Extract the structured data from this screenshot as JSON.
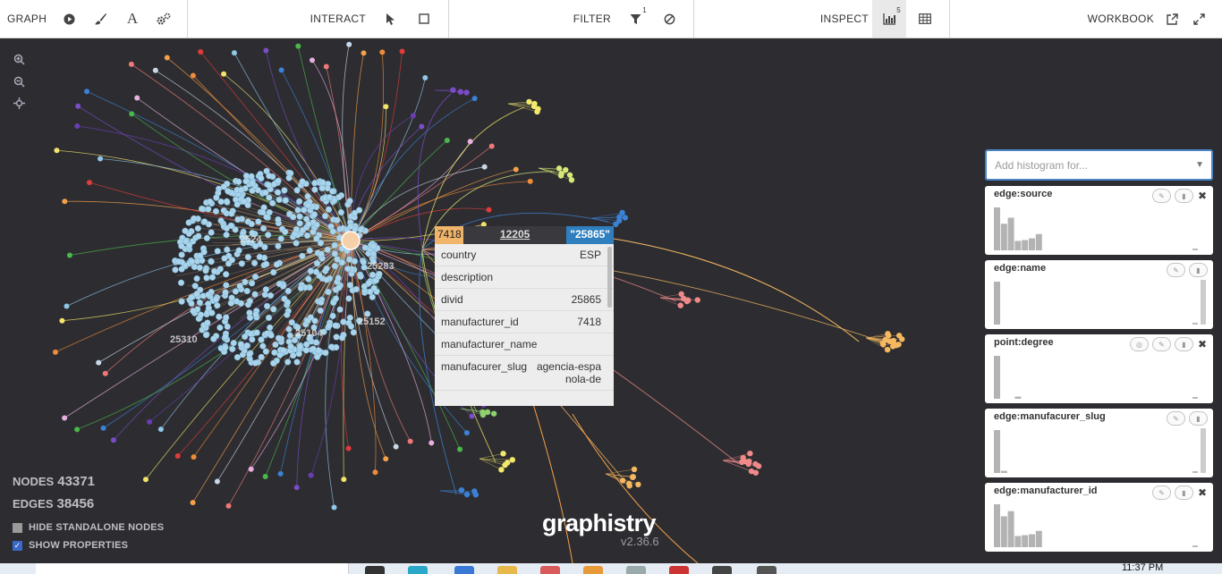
{
  "toolbar": {
    "graph_label": "GRAPH",
    "interact_label": "INTERACT",
    "filter_label": "FILTER",
    "filter_count": "1",
    "inspect_label": "INSPECT",
    "inspect_count": "5",
    "workbook_label": "WORKBOOK"
  },
  "icons": {
    "play": "play-icon",
    "brush": "brush-icon",
    "font": "font-icon",
    "settings": "gears-icon",
    "pointer": "pointer-icon",
    "box_select": "square-icon",
    "filter": "filter-icon",
    "exclude": "ban-icon",
    "histogram": "bar-chart-icon",
    "table": "table-icon",
    "external": "external-link-icon",
    "fullscreen": "expand-icon"
  },
  "canvas": {
    "background": "#2d2d31",
    "cluster_labels": [
      "7418",
      "25283",
      "25152",
      "25310",
      "25104",
      "2524"
    ],
    "popup": {
      "source_id": "7418",
      "edge_id": "12205",
      "dest_id": "\"25865\"",
      "rows": [
        {
          "key": "country",
          "value": "ESP"
        },
        {
          "key": "description",
          "value": ""
        },
        {
          "key": "divid",
          "value": "25865"
        },
        {
          "key": "manufacturer_id",
          "value": "7418"
        },
        {
          "key": "manufacturer_name",
          "value": ""
        },
        {
          "key": "manufacurer_slug",
          "value": "agencia-espanola-de"
        }
      ]
    }
  },
  "stats": {
    "nodes_label": "NODES",
    "nodes_value": "43371",
    "edges_label": "EDGES",
    "edges_value": "38456",
    "hide_standalone": "HIDE STANDALONE NODES",
    "show_properties": "SHOW PROPERTIES"
  },
  "logo": {
    "name": "graphistry",
    "version": "v2.36.6"
  },
  "histograms": {
    "placeholder": "Add histogram for...",
    "cards": [
      {
        "title": "edge:source",
        "bars": [
          1.0,
          0.62,
          0.76,
          0.22,
          0.24,
          0.28,
          0.38
        ],
        "close": true,
        "scroll": false
      },
      {
        "title": "edge:name",
        "bars": [
          1.0
        ],
        "close": false,
        "scroll": true
      },
      {
        "title": "point:degree",
        "bars": [
          1.0,
          0,
          0,
          0.05
        ],
        "close": true,
        "scroll": false
      },
      {
        "title": "edge:manufacurer_slug",
        "bars": [
          1.0,
          0.05
        ],
        "close": false,
        "scroll": true
      },
      {
        "title": "edge:manufacturer_id",
        "bars": [
          1.0,
          0.72,
          0.84,
          0.26,
          0.28,
          0.3,
          0.38
        ],
        "close": true,
        "scroll": false
      }
    ]
  },
  "taskbar": {
    "time": "11:37 PM"
  }
}
